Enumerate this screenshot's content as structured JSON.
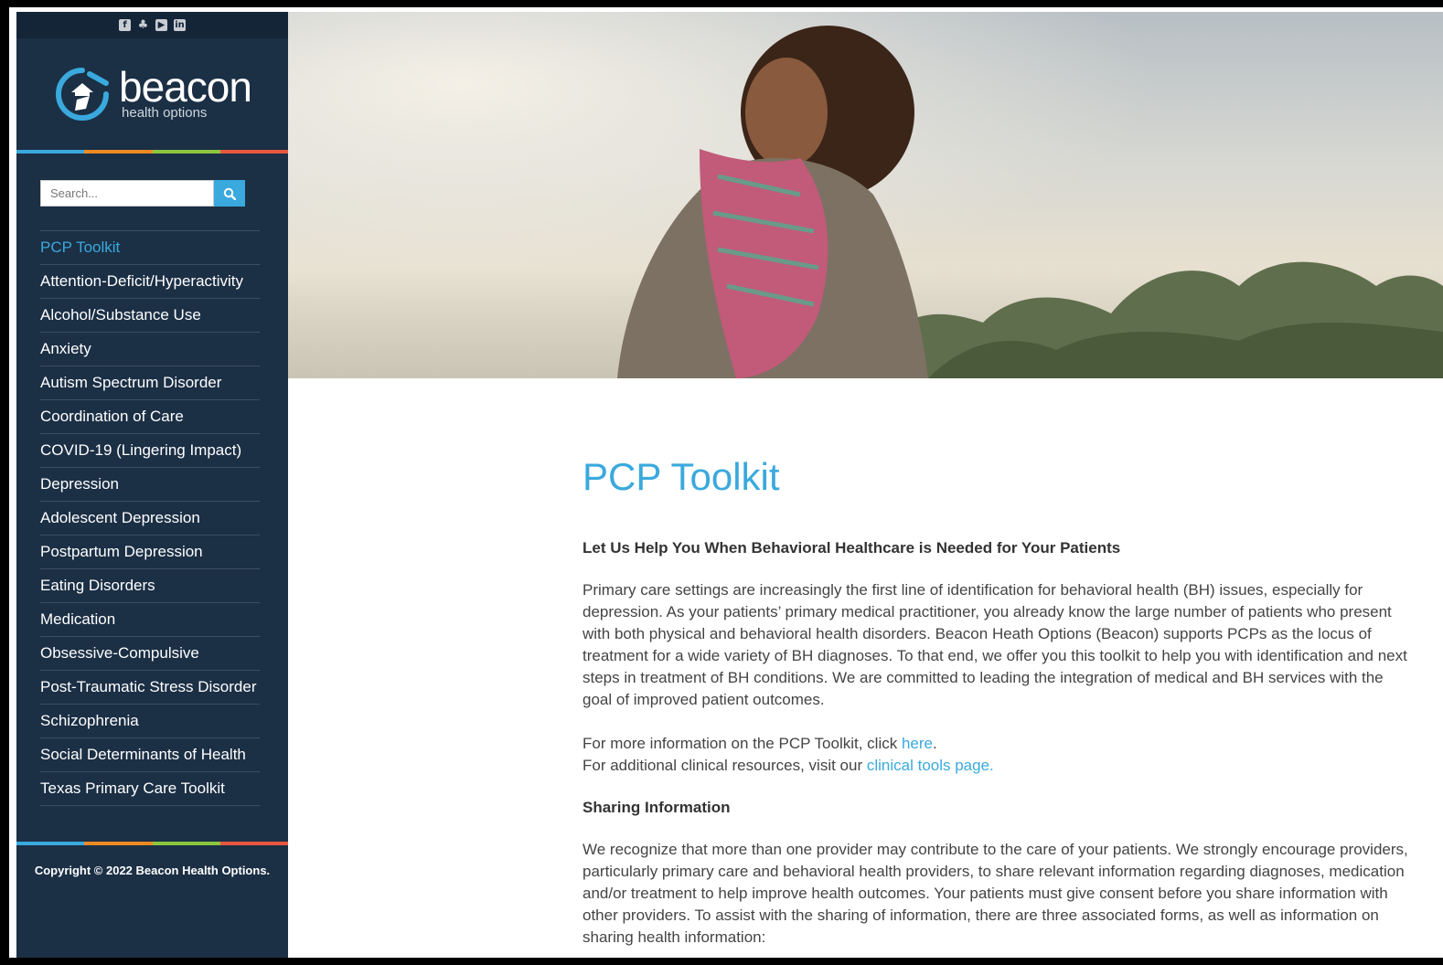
{
  "social": [
    {
      "icon": "facebook-icon",
      "glyph": "f"
    },
    {
      "icon": "twitter-icon",
      "glyph": "♣"
    },
    {
      "icon": "youtube-icon",
      "glyph": "▶"
    },
    {
      "icon": "linkedin-icon",
      "glyph": "in"
    }
  ],
  "logo": {
    "main": "beacon",
    "sub": "health options"
  },
  "stripe_colors": [
    "#3aa9dd",
    "#f08a24",
    "#8dc63f",
    "#e9573f"
  ],
  "search": {
    "placeholder": "Search..."
  },
  "accent": "#3aa9dd",
  "nav": {
    "items": [
      "PCP Toolkit",
      "Attention-Deficit/Hyperactivity",
      "Alcohol/Substance Use",
      "Anxiety",
      "Autism Spectrum Disorder",
      "Coordination of Care",
      "COVID-19 (Lingering Impact)",
      "Depression",
      "Adolescent Depression",
      "Postpartum Depression",
      "Eating Disorders",
      "Medication",
      "Obsessive-Compulsive",
      "Post-Traumatic Stress Disorder",
      "Schizophrenia",
      "Social Determinants of Health",
      "Texas Primary Care Toolkit"
    ],
    "active": "PCP Toolkit"
  },
  "copyright": "Copyright © 2022 Beacon Health Options.",
  "main": {
    "title": "PCP Toolkit",
    "heading1": "Let Us Help You When Behavioral Healthcare is Needed for Your Patients",
    "intro_lines": [
      "Primary care settings are increasingly the first line of identification for behavioral health (BH) issues, especially for",
      "depression. As your patients’ primary medical practitioner, you already know the large number of patients who present",
      "with both physical and behavioral health disorders. Beacon Heath Options (Beacon) supports PCPs as the locus of",
      "treatment for a wide variety of BH diagnoses. To that end, we offer you this toolkit to help you with identification and next",
      "steps in treatment of BH conditions. We are committed to leading the integration of medical and BH services with the",
      "goal of improved patient outcomes."
    ],
    "more_info_prefix": "For more information on the PCP Toolkit, click ",
    "more_info_link": "here",
    "more_info_suffix": ".",
    "clinical_prefix": "For additional clinical resources, visit our ",
    "clinical_link": "clinical tools page.",
    "heading2": "Sharing Information",
    "sharing_lines": [
      "We recognize that more than one provider may contribute to the care of your patients. We strongly encourage providers,",
      "particularly primary care and behavioral health providers, to share relevant information regarding diagnoses, medication",
      "and/or treatment to help improve health outcomes. Your patients must give consent before you share information with",
      "other providers. To assist with the sharing of information, there are three associated forms, as well as information on",
      "sharing health information:"
    ]
  }
}
